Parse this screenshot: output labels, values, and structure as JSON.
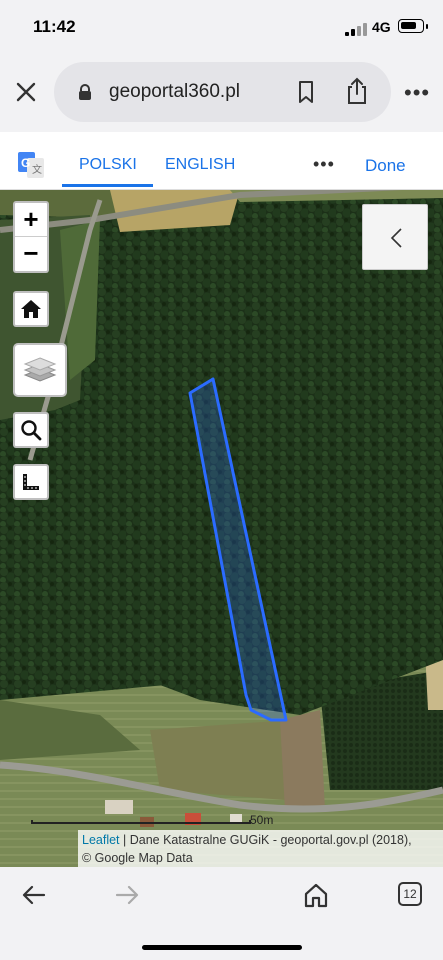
{
  "status_bar": {
    "time": "11:42",
    "network": "4G",
    "battery_level": 0.8
  },
  "browser": {
    "url": "geoportal360.pl",
    "icons": {
      "close": "close-icon",
      "lock": "lock-icon",
      "bookmark": "bookmark-icon",
      "share": "share-icon",
      "more": "more-icon"
    }
  },
  "translate_bar": {
    "languages": [
      "POLSKI",
      "ENGLISH"
    ],
    "selected": "POLSKI",
    "more_label": "•••",
    "done_label": "Done"
  },
  "map": {
    "zoom_in_label": "+",
    "zoom_out_label": "−",
    "controls": [
      "home-icon",
      "layers-icon",
      "search-icon",
      "measure-icon"
    ],
    "scale_label": "50m",
    "attribution": {
      "link": "Leaflet",
      "text": " | Dane Katastralne GUGiK - geoportal.gov.pl (2018),",
      "line2": "© Google Map Data"
    },
    "parcel_color": "#2b6bff"
  },
  "bottom_bar": {
    "tabs_count": "12",
    "icons": [
      "back-arrow-icon",
      "forward-arrow-icon",
      "home-icon",
      "tabs-icon"
    ]
  }
}
